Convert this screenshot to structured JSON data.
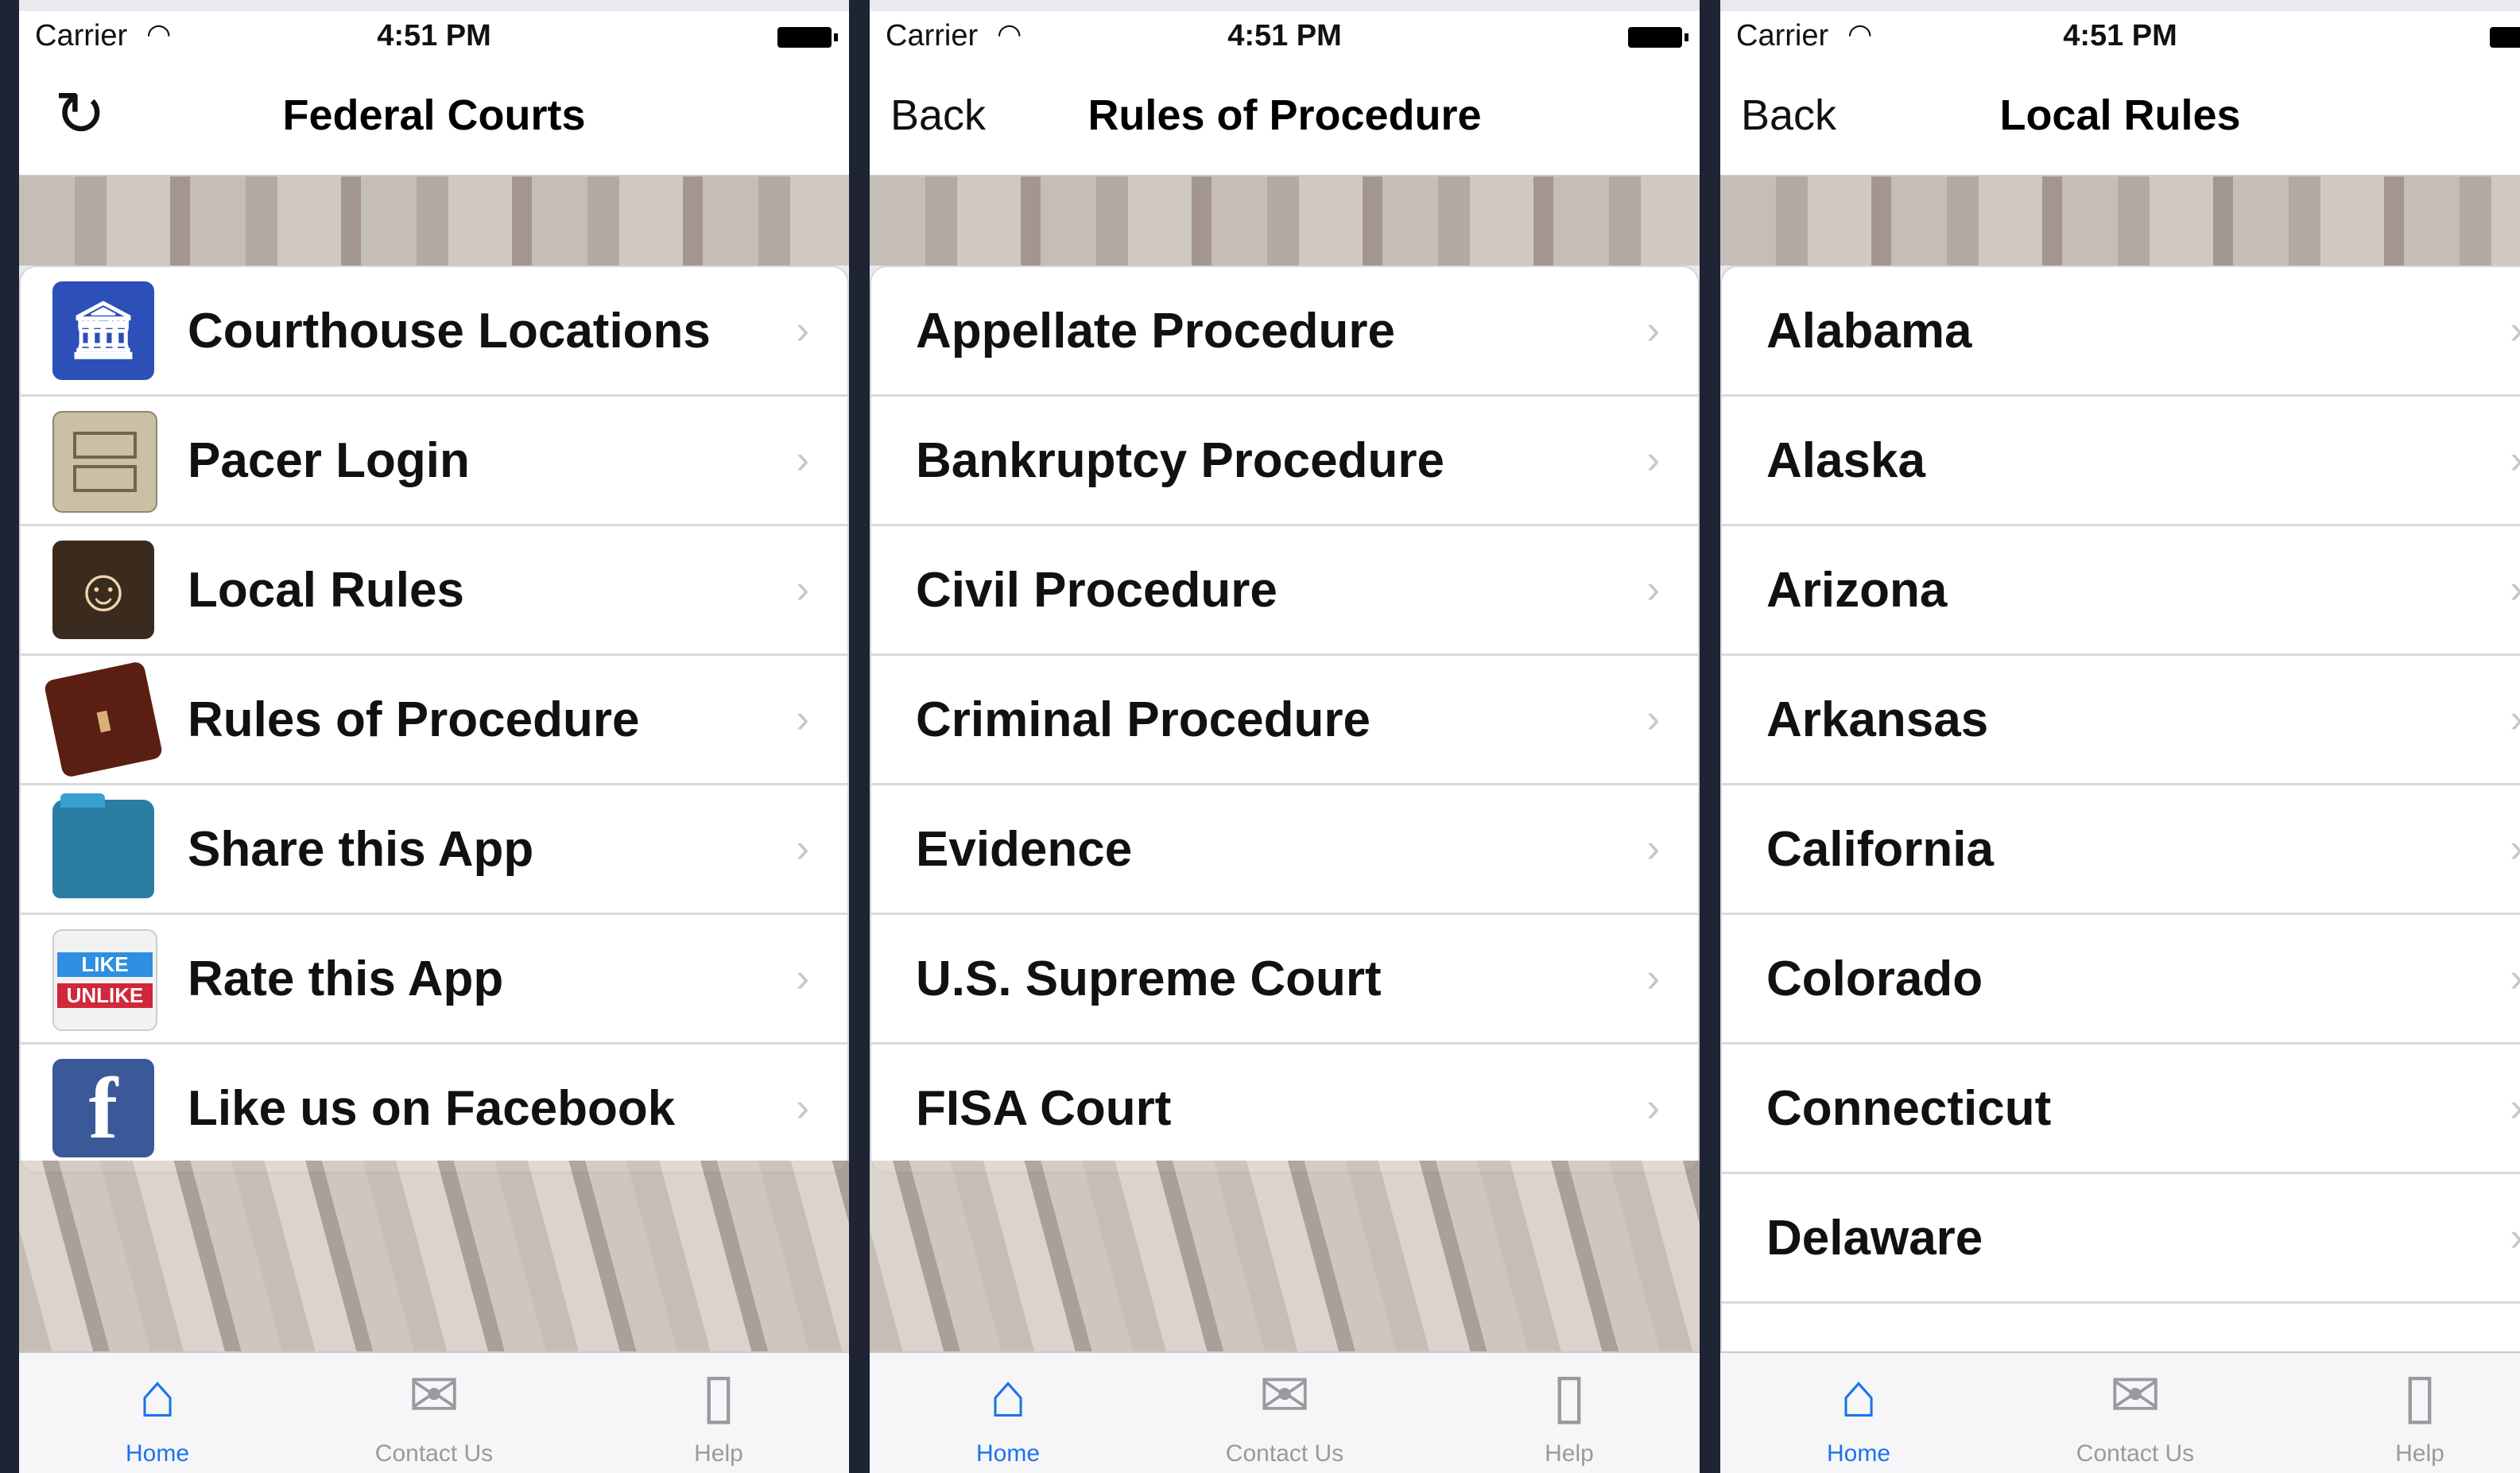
{
  "status": {
    "carrier": "Carrier",
    "time": "4:51 PM"
  },
  "screens": [
    {
      "title": "Federal Courts",
      "items": [
        {
          "label": "Courthouse Locations",
          "icon": "courthouse-icon"
        },
        {
          "label": "Pacer Login",
          "icon": "file-cabinet-icon"
        },
        {
          "label": "Local Rules",
          "icon": "judge-icon"
        },
        {
          "label": "Rules of Procedure",
          "icon": "law-book-icon"
        },
        {
          "label": "Share this App",
          "icon": "folder-icon"
        },
        {
          "label": "Rate this App",
          "icon": "like-unlike-icon",
          "like_text": "LIKE",
          "unlike_text": "UNLIKE"
        },
        {
          "label": "Like us on Facebook",
          "icon": "facebook-icon"
        }
      ]
    },
    {
      "title": "Rules of Procedure",
      "back": "Back",
      "items": [
        {
          "label": "Appellate Procedure"
        },
        {
          "label": "Bankruptcy Procedure"
        },
        {
          "label": "Civil Procedure"
        },
        {
          "label": "Criminal Procedure"
        },
        {
          "label": "Evidence"
        },
        {
          "label": "U.S. Supreme Court"
        },
        {
          "label": "FISA Court"
        }
      ]
    },
    {
      "title": "Local Rules",
      "back": "Back",
      "items": [
        {
          "label": "Alabama"
        },
        {
          "label": "Alaska"
        },
        {
          "label": "Arizona"
        },
        {
          "label": "Arkansas"
        },
        {
          "label": "California"
        },
        {
          "label": "Colorado"
        },
        {
          "label": "Connecticut"
        },
        {
          "label": "Delaware"
        }
      ]
    }
  ],
  "tabbar": {
    "home": "Home",
    "contact": "Contact Us",
    "help": "Help"
  },
  "colors": {
    "accent": "#1d73e8",
    "tab_inactive": "#9a9a9e"
  }
}
